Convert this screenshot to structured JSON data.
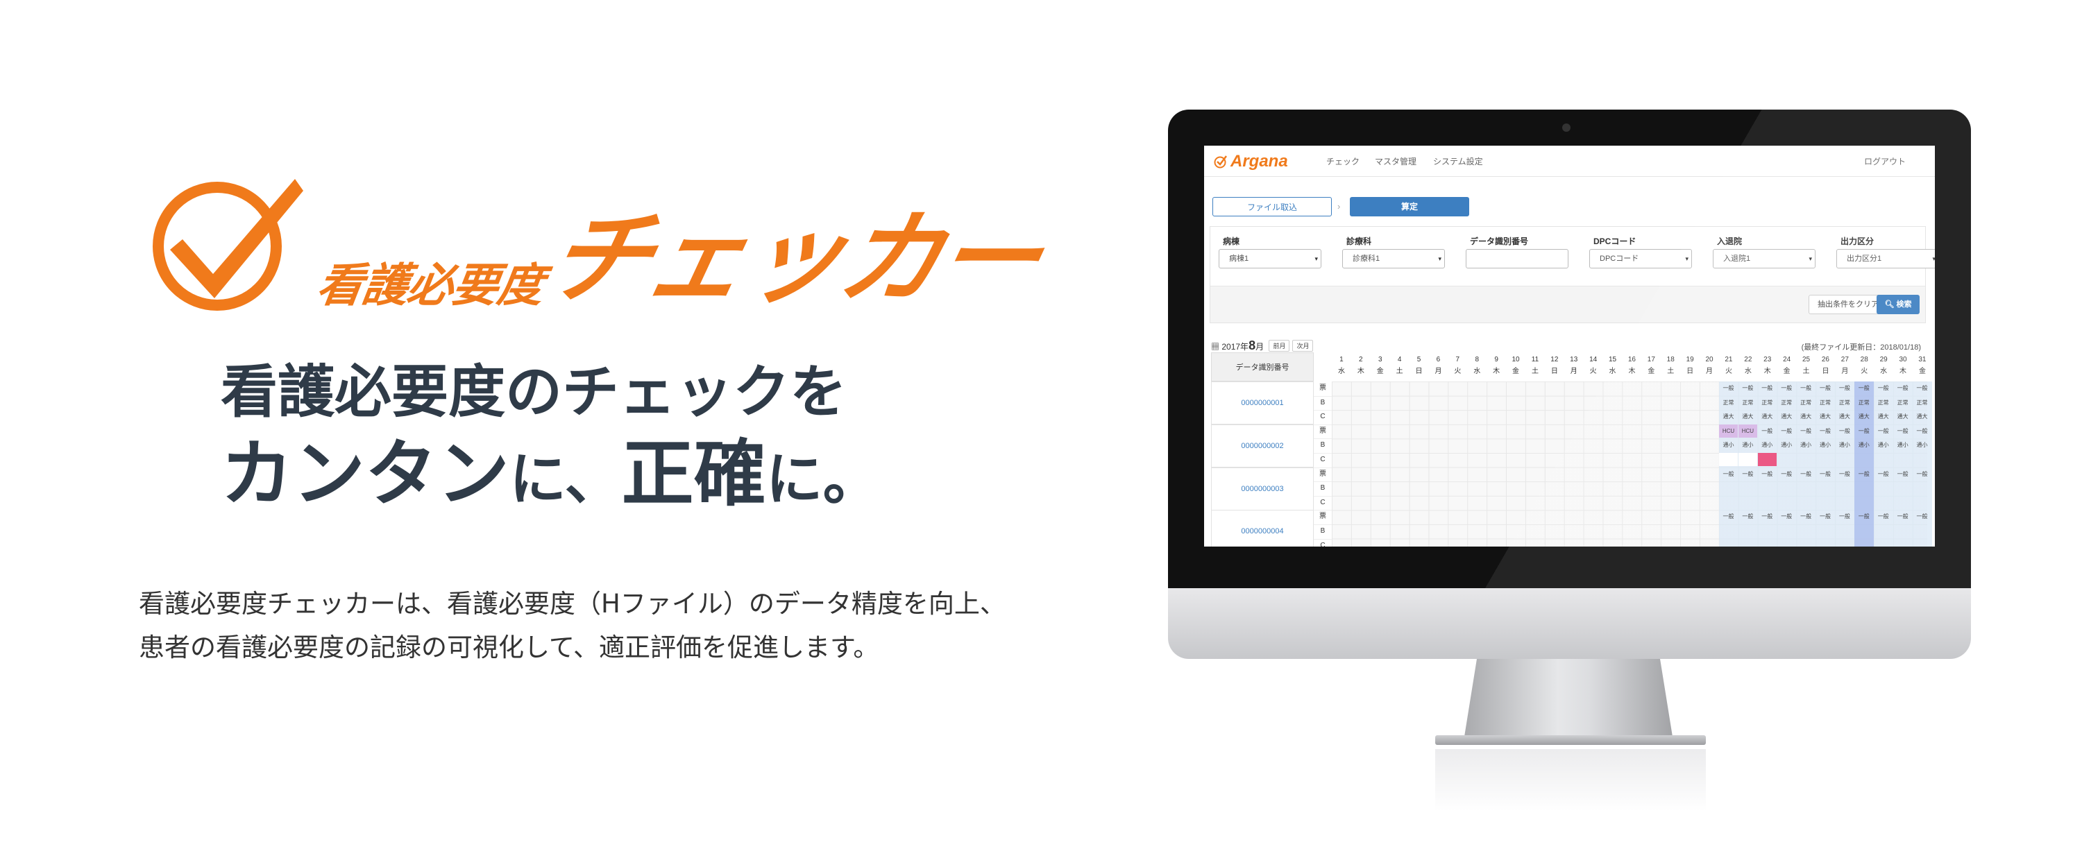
{
  "logo": {
    "sub": "看護必要度",
    "main": "チェッカー",
    "accent_color": "#f07a1b",
    "icon": "checkmark-circle-icon"
  },
  "headline": {
    "line1": "看護必要度のチェックを",
    "line2_a": "カンタン",
    "line2_b": "に、",
    "line2_c": "正確",
    "line2_d": "に。"
  },
  "description": {
    "line1": "看護必要度チェッカーは、看護必要度（Hファイル）のデータ精度を向上、",
    "line2": "患者の看護必要度の記録の可視化して、適正評価を促進します。"
  },
  "app": {
    "brand": "Argana",
    "nav": [
      "チェック",
      "マスタ管理",
      "システム設定"
    ],
    "logout": "ログアウト",
    "steps": [
      "ファイル取込",
      "算定"
    ],
    "step_separator": "›",
    "filters": [
      {
        "label": "病棟",
        "value": "病棟1",
        "type": "select"
      },
      {
        "label": "診療科",
        "value": "診療科1",
        "type": "select"
      },
      {
        "label": "データ識別番号",
        "value": "",
        "type": "text"
      },
      {
        "label": "DPCコード",
        "value": "DPCコード",
        "type": "select"
      },
      {
        "label": "入退院",
        "value": "入退院1",
        "type": "select"
      },
      {
        "label": "出力区分",
        "value": "出力区分1",
        "type": "select"
      }
    ],
    "clear_button": "抽出条件をクリア",
    "search_button": "検索",
    "month": {
      "year_label": "2017年",
      "month": "8",
      "month_suffix": "月",
      "prev": "前月",
      "next": "次月"
    },
    "last_update": "(最終ファイル更新日：2018/01/18)",
    "grid_header": "データ識別番号",
    "days": [
      "1",
      "2",
      "3",
      "4",
      "5",
      "6",
      "7",
      "8",
      "9",
      "10",
      "11",
      "12",
      "13",
      "14",
      "15",
      "16",
      "17",
      "18",
      "19",
      "20",
      "21",
      "22",
      "23",
      "24",
      "25",
      "26",
      "27",
      "28",
      "29",
      "30",
      "31"
    ],
    "weekdays": [
      "水",
      "木",
      "金",
      "土",
      "日",
      "月",
      "火",
      "水",
      "木",
      "金",
      "土",
      "日",
      "月",
      "火",
      "水",
      "木",
      "金",
      "土",
      "日",
      "月",
      "火",
      "水",
      "木",
      "金",
      "土",
      "日",
      "月",
      "火",
      "水",
      "木",
      "金"
    ],
    "row_types": [
      "票",
      "B",
      "C"
    ],
    "records": [
      "0000000001",
      "0000000002",
      "0000000003",
      "0000000004"
    ],
    "cell_values": {
      "ippan": "一般",
      "seijo": "正常",
      "tsuusho": "通大",
      "tsuusho_small": "通小",
      "hcu": "HCU"
    }
  }
}
